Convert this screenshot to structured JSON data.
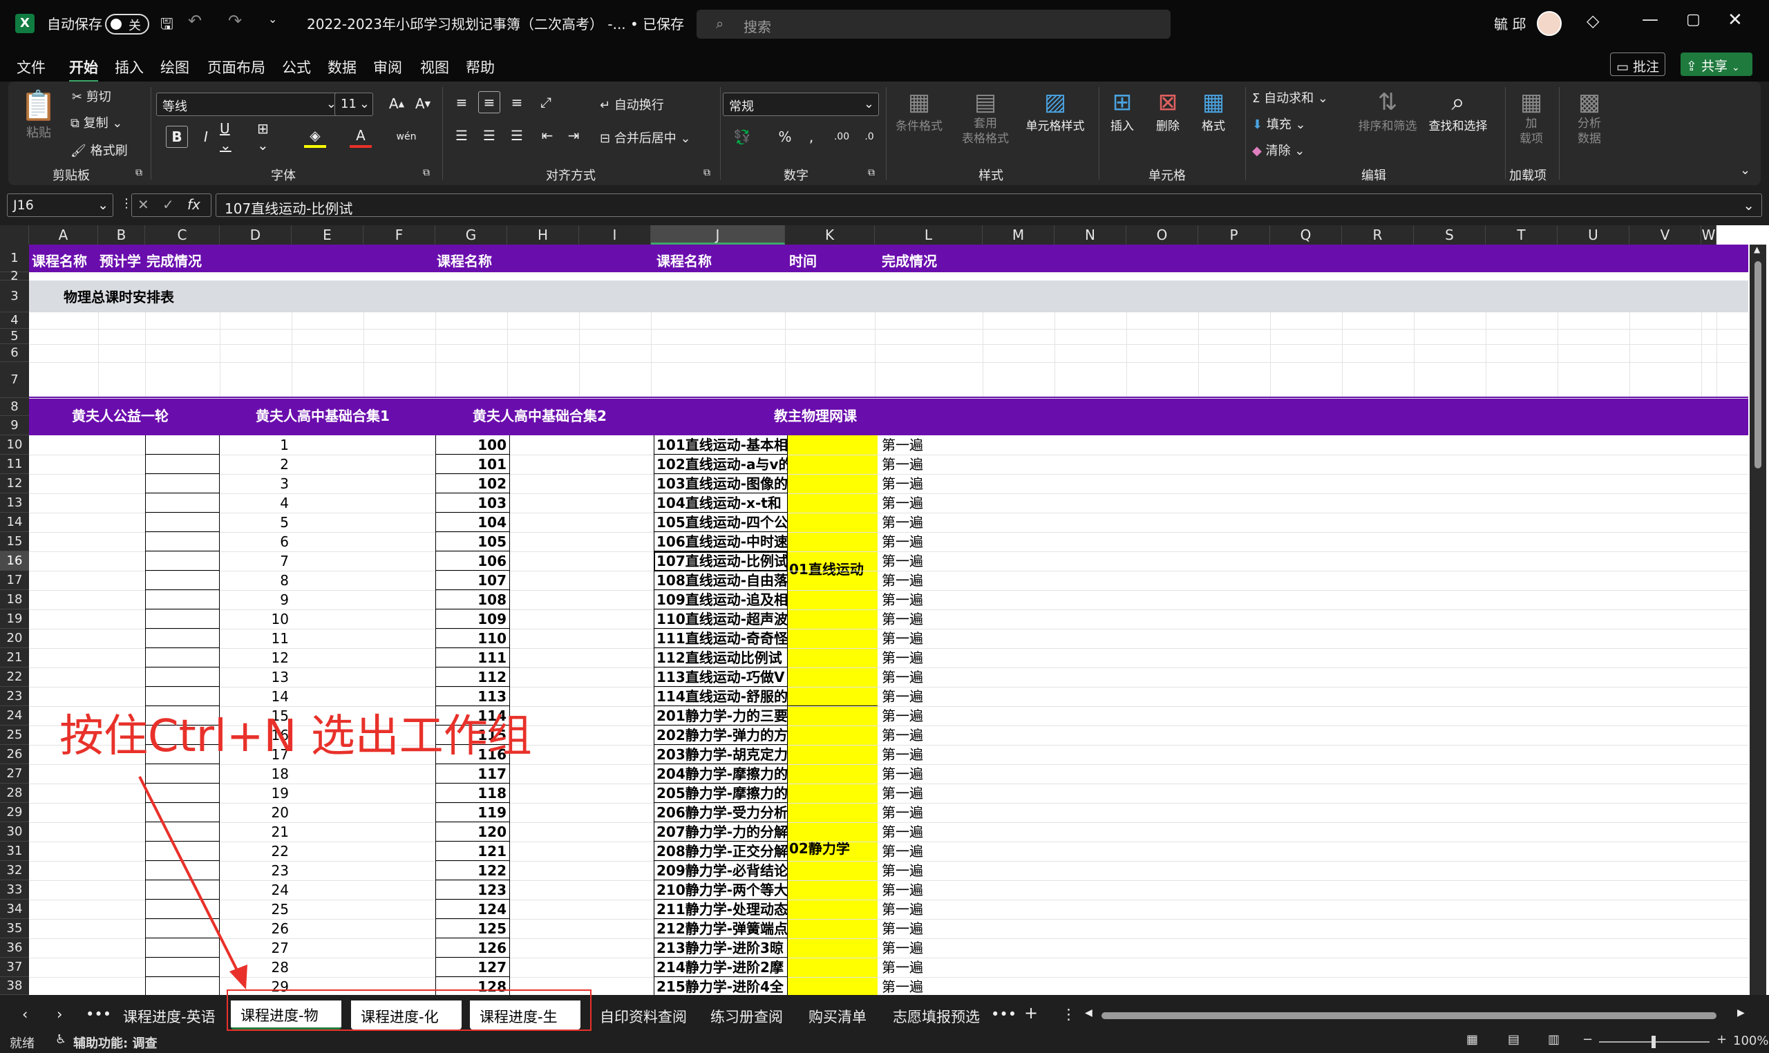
{
  "titlebar": {
    "autosave_label": "自动保存",
    "autosave_state": "关",
    "doc_title": "2022-2023年小邱学习规划记事簿（二次高考）  -...  • 已保存",
    "search_placeholder": "搜索",
    "user": "毓 邱"
  },
  "menu": [
    "文件",
    "开始",
    "插入",
    "绘图",
    "页面布局",
    "公式",
    "数据",
    "审阅",
    "视图",
    "帮助"
  ],
  "menu_right": {
    "comment": "批注",
    "share": "共享"
  },
  "ribbon": {
    "paste": "粘贴",
    "cut": "剪切",
    "copy": "复制",
    "format_painter": "格式刷",
    "g_clipboard": "剪贴板",
    "font_name": "等线",
    "font_size": "11",
    "g_font": "字体",
    "wrap": "自动换行",
    "merge": "合并后居中",
    "g_align": "对齐方式",
    "number_format": "常规",
    "g_number": "数字",
    "cond_format": "条件格式",
    "table_format": "套用\n表格格式",
    "cell_style": "单元格样式",
    "g_style": "样式",
    "insert": "插入",
    "delete": "删除",
    "format": "格式",
    "g_cells": "单元格",
    "autosum": "自动求和",
    "fill": "填充",
    "clear": "清除",
    "sort": "排序和筛选",
    "find": "查找和选择",
    "g_edit": "编辑",
    "addin": "加\n载项",
    "g_addin": "加载项",
    "analyze": "分析\n数据"
  },
  "formula_bar": {
    "name_box": "J16",
    "formula": "107直线运动-比例试",
    "fx": "fx"
  },
  "columns": [
    "A",
    "B",
    "C",
    "D",
    "E",
    "F",
    "G",
    "H",
    "I",
    "J",
    "K",
    "L",
    "M",
    "N",
    "O",
    "P",
    "Q",
    "R",
    "S",
    "T",
    "U",
    "V",
    "W"
  ],
  "header_row": {
    "a": "课程名称",
    "b": "预计学",
    "c": "完成情况",
    "g": "课程名称",
    "j": "课程名称",
    "k": "时间",
    "l": "完成情况"
  },
  "row3_title": "物理总课时安排表",
  "section_headers": {
    "a": "黄夫人公益一轮",
    "d": "黄夫人高中基础合集1",
    "g": "黄夫人高中基础合集2",
    "j": "教主物理网课"
  },
  "row_numbers": [
    "1",
    "2",
    "3",
    "4",
    "5",
    "6",
    "7",
    "8",
    "9",
    "10",
    "11",
    "12",
    "13",
    "14",
    "15",
    "16",
    "17",
    "18",
    "19",
    "20",
    "21",
    "22",
    "23",
    "24",
    "25",
    "26",
    "27",
    "28",
    "29",
    "30",
    "31",
    "32",
    "33",
    "34",
    "35",
    "36",
    "37",
    "38"
  ],
  "col_d": [
    "1",
    "2",
    "3",
    "4",
    "5",
    "6",
    "7",
    "8",
    "9",
    "10",
    "11",
    "12",
    "13",
    "14",
    "15",
    "16",
    "17",
    "18",
    "19",
    "20",
    "21",
    "22",
    "23",
    "24",
    "25",
    "26",
    "27",
    "28",
    "29"
  ],
  "col_g": [
    "100",
    "101",
    "102",
    "103",
    "104",
    "105",
    "106",
    "107",
    "108",
    "109",
    "110",
    "111",
    "112",
    "113",
    "114",
    "115",
    "116",
    "117",
    "118",
    "119",
    "120",
    "121",
    "122",
    "123",
    "124",
    "125",
    "126",
    "127",
    "128"
  ],
  "col_j": [
    "101直线运动-基本相",
    "102直线运动-a与v的",
    "103直线运动-图像的",
    "104直线运动-x-t和",
    "105直线运动-四个公",
    "106直线运动-中时速",
    "107直线运动-比例试",
    "108直线运动-自由落",
    "109直线运动-追及相",
    "110直线运动-超声波",
    "111直线运动-奇奇怪",
    "112直线运动比例试",
    "113直线运动-巧做V",
    "114直线运动-舒服的",
    "201静力学-力的三要",
    "202静力学-弹力的方",
    "203静力学-胡克定力",
    "204静力学-摩擦力的",
    "205静力学-摩擦力的",
    "206静力学-受力分析",
    "207静力学-力的分解",
    "208静力学-正交分解",
    "209静力学-必背结论",
    "210静力学-两个等大",
    "211静力学-处理动态",
    "212静力学-弹簧端点",
    "213静力学-进阶3晾",
    "214静力学-进阶2摩",
    "215静力学-进阶4全"
  ],
  "k_labels": {
    "first": "01直线运动",
    "second": "02静力学"
  },
  "l_value": "第一遍",
  "annotation": "按住Ctrl+N 选出工作组",
  "sheet_tabs": [
    "课程进度-英语",
    "课程进度-物理",
    "课程进度-化学",
    "课程进度-生物",
    "自印资料查阅",
    "练习册查阅",
    "购买清单",
    "志愿填报预选"
  ],
  "status": {
    "ready": "就绪",
    "accessibility": "辅助功能: 调查",
    "zoom": "100%"
  },
  "colors": {
    "purple": "#6a0dad",
    "yellow": "#ffff00",
    "gray_row": "#d9dce1",
    "annotation": "#e8312a",
    "share_green": "#1f7a3d"
  }
}
